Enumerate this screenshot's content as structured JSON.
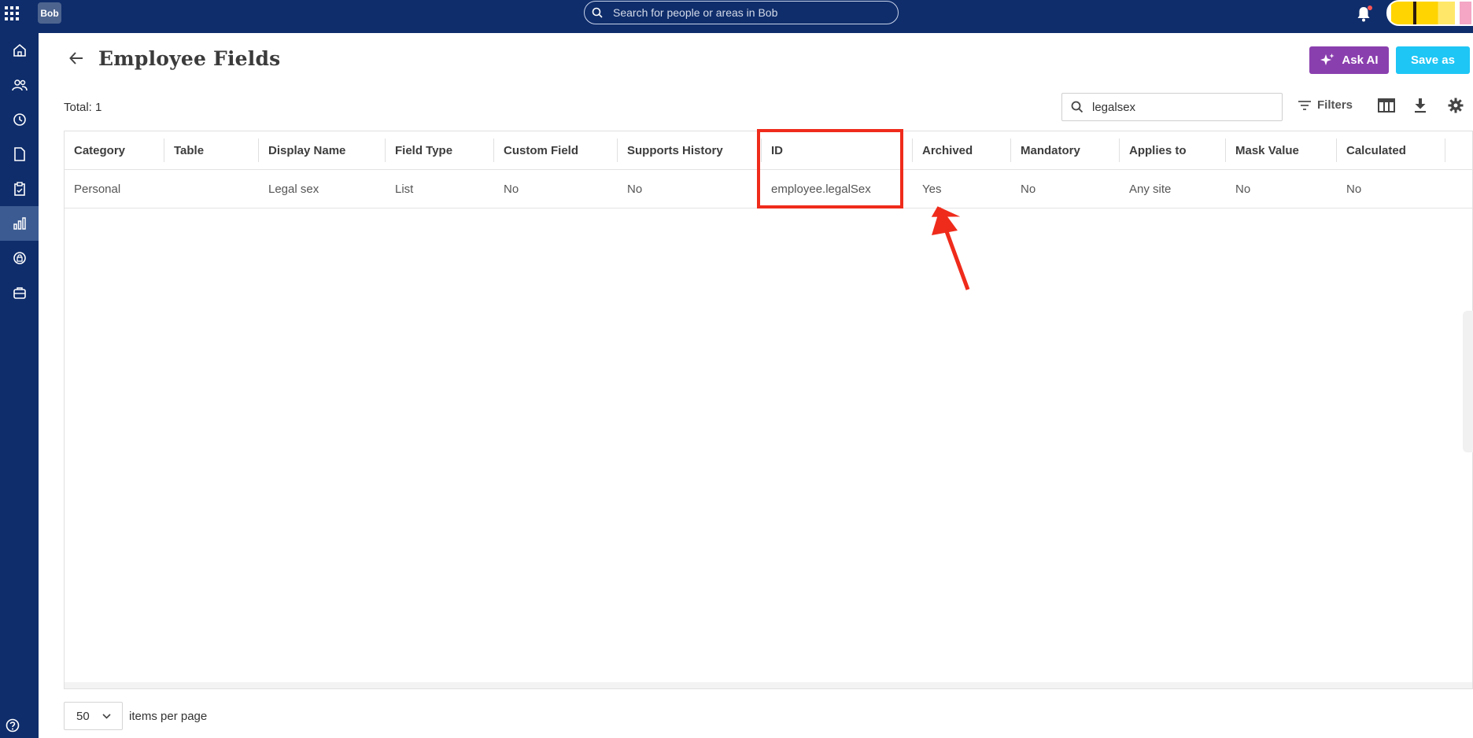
{
  "topbar": {
    "logo": "Bob",
    "search_placeholder": "Search for people or areas in Bob"
  },
  "header": {
    "title": "Employee Fields",
    "ask_ai_label": "Ask AI",
    "save_as_label": "Save as"
  },
  "toolbar": {
    "total": "Total: 1",
    "search_value": "legalsex",
    "filters_label": "Filters"
  },
  "table": {
    "columns": [
      "Category",
      "Table",
      "Display Name",
      "Field Type",
      "Custom Field",
      "Supports History",
      "ID",
      "Archived",
      "Mandatory",
      "Applies to",
      "Mask Value",
      "Calculated"
    ],
    "rows": [
      [
        "Personal",
        "",
        "Legal sex",
        "List",
        "No",
        "No",
        "employee.legalSex",
        "Yes",
        "No",
        "Any site",
        "No",
        "No"
      ]
    ]
  },
  "footer": {
    "page_size": "50",
    "items_per_page_label": "items per page"
  },
  "annotation": {
    "highlight_color": "#ef2b1b"
  }
}
